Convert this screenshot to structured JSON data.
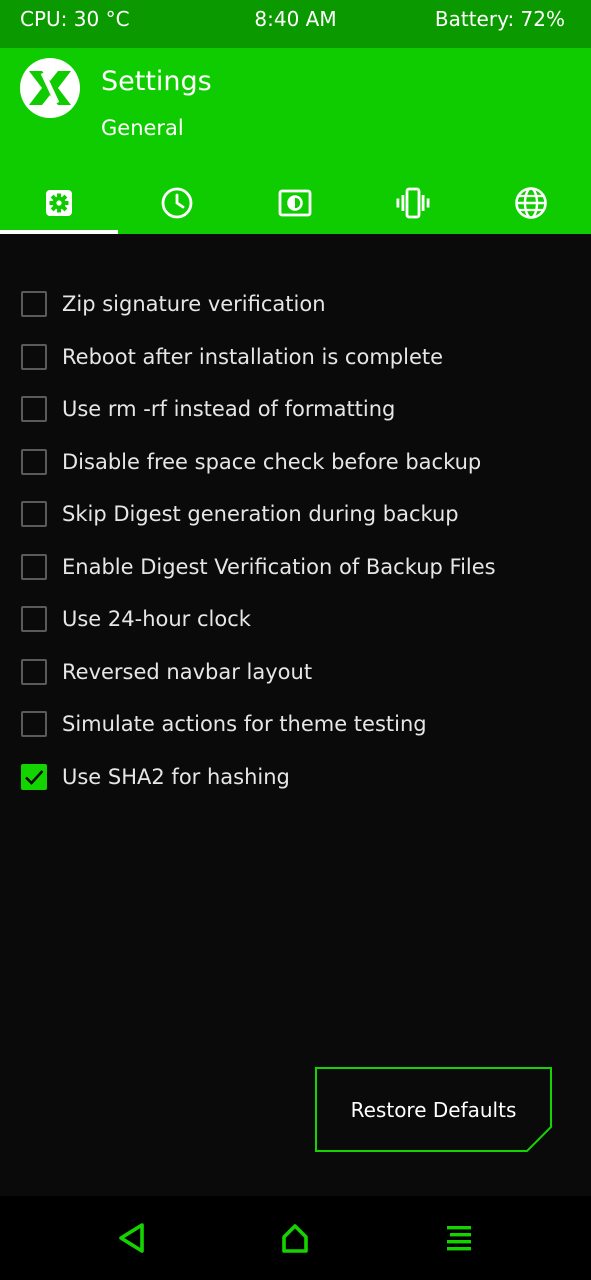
{
  "status_bar": {
    "cpu": "CPU: 30 °C",
    "time": "8:40 AM",
    "battery": "Battery: 72%"
  },
  "header": {
    "title": "Settings",
    "subtitle": "General",
    "tabs": [
      {
        "icon": "gear-icon",
        "selected": true
      },
      {
        "icon": "clock-icon",
        "selected": false
      },
      {
        "icon": "brightness-icon",
        "selected": false
      },
      {
        "icon": "vibrate-icon",
        "selected": false
      },
      {
        "icon": "globe-icon",
        "selected": false
      }
    ]
  },
  "options": [
    {
      "label": "Zip signature verification",
      "checked": false
    },
    {
      "label": "Reboot after installation is complete",
      "checked": false
    },
    {
      "label": "Use rm -rf instead of formatting",
      "checked": false
    },
    {
      "label": "Disable free space check before backup",
      "checked": false
    },
    {
      "label": "Skip Digest generation during backup",
      "checked": false
    },
    {
      "label": "Enable Digest Verification of Backup Files",
      "checked": false
    },
    {
      "label": "Use 24-hour clock",
      "checked": false
    },
    {
      "label": "Reversed navbar layout",
      "checked": false
    },
    {
      "label": "Simulate actions for theme testing",
      "checked": false
    },
    {
      "label": "Use SHA2 for hashing",
      "checked": true
    }
  ],
  "restore_button": {
    "label": "Restore Defaults"
  },
  "nav_bar": {
    "buttons": [
      "back-icon",
      "home-icon",
      "menu-icon"
    ]
  },
  "colors": {
    "status_bar": "#0a9a00",
    "header": "#0fcc00",
    "accent": "#14d400",
    "background": "#0a0a0a",
    "nav_icon": "#14d400"
  }
}
